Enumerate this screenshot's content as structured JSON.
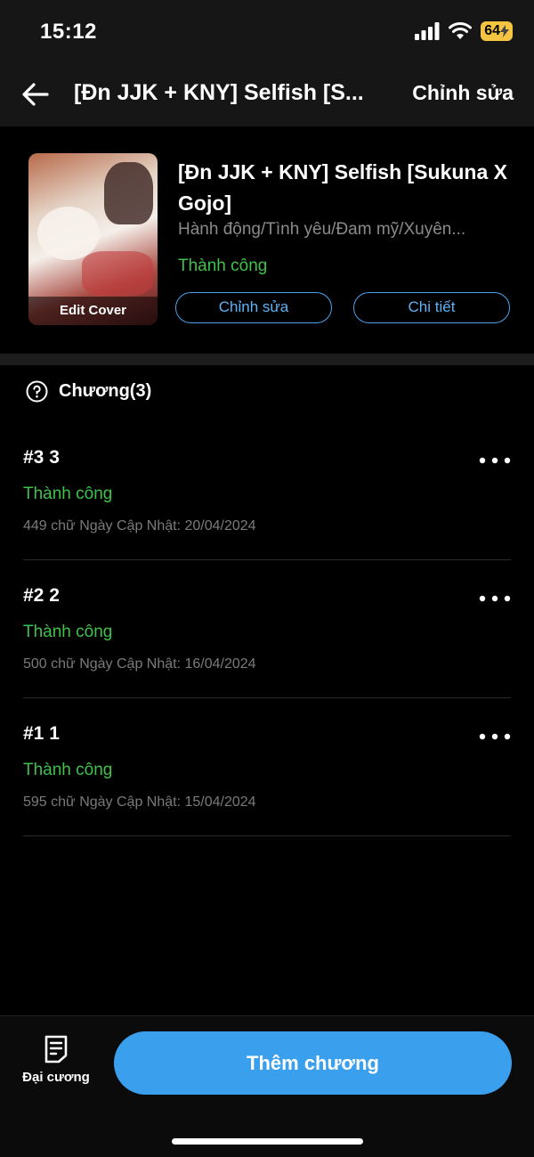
{
  "status_bar": {
    "time": "15:12",
    "battery": "64"
  },
  "nav": {
    "back_icon": "arrow-left-icon",
    "title": "[Đn JJK + KNY] Selfish [S...",
    "edit_label": "Chỉnh sửa"
  },
  "book": {
    "cover_label": "Edit Cover",
    "title": "[Đn JJK + KNY] Selfish [Sukuna X Gojo]",
    "genres": "Hành động/Tình yêu/Đam mỹ/Xuyên...",
    "status": "Thành công",
    "edit_button": "Chỉnh sửa",
    "detail_button": "Chi tiết"
  },
  "chapters_section": {
    "title": "Chương(3)",
    "items": [
      {
        "title": "#3 3",
        "status": "Thành công",
        "meta": "449 chữ Ngày Cập Nhật: 20/04/2024"
      },
      {
        "title": "#2 2",
        "status": "Thành công",
        "meta": "500 chữ Ngày Cập Nhật: 16/04/2024"
      },
      {
        "title": "#1 1",
        "status": "Thành công",
        "meta": "595 chữ Ngày Cập Nhật: 15/04/2024"
      }
    ]
  },
  "bottom": {
    "outline_label": "Đại cương",
    "add_chapter": "Thêm chương"
  },
  "colors": {
    "accent": "#3aa0ee",
    "success": "#3fc24a",
    "battery": "#f5c542"
  }
}
